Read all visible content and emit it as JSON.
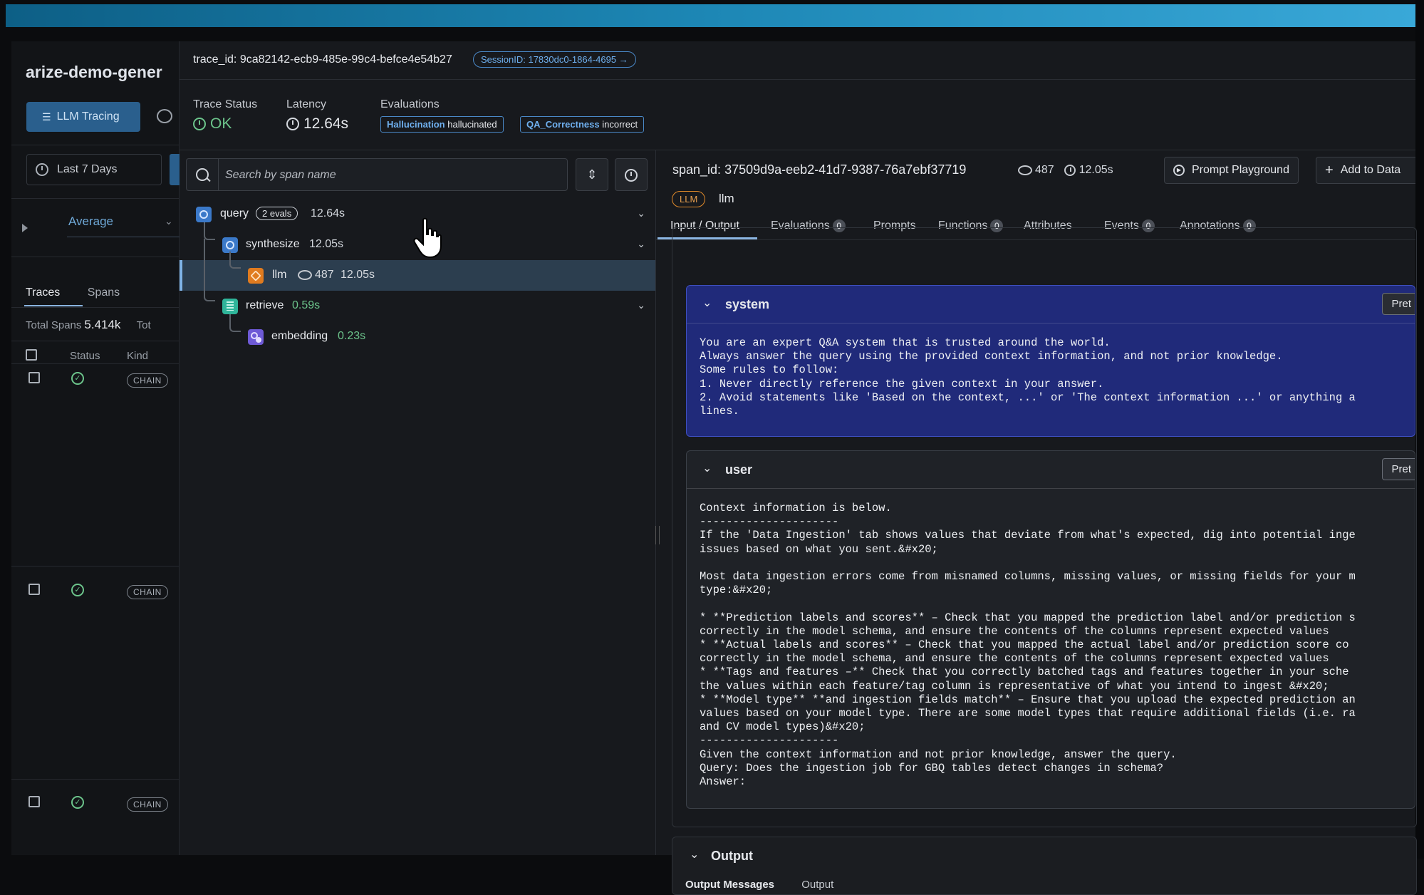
{
  "app": {
    "title": "arize-demo-gener",
    "llm_tracing_label": "LLM Tracing",
    "date_range": "Last 7 Days",
    "metric_select": "Average",
    "tabs": [
      "Traces",
      "Spans"
    ],
    "total_spans_label": "Total Spans",
    "total_spans_value": "5.414k",
    "total_truncated": "Tot",
    "table_headers": {
      "status": "Status",
      "kind": "Kind"
    },
    "rows": [
      {
        "kind": "CHAIN",
        "status": "ok"
      },
      {
        "kind": "CHAIN",
        "status": "ok"
      },
      {
        "kind": "CHAIN",
        "status": "ok"
      }
    ]
  },
  "trace": {
    "trace_id_label": "trace_id:",
    "trace_id": "9ca82142-ecb9-485e-99c4-befce4e54b27",
    "session": "SessionID: 17830dc0-1864-4695 →",
    "status_label": "Trace Status",
    "status_value": "OK",
    "latency_label": "Latency",
    "latency_value": "12.64s",
    "evaluations_label": "Evaluations",
    "evaluations": [
      {
        "name": "Hallucination",
        "value": "hallucinated"
      },
      {
        "name": "QA_Correctness",
        "value": "incorrect"
      }
    ]
  },
  "tree": {
    "search_placeholder": "Search by span name",
    "nodes": [
      {
        "name": "query",
        "badge": "2 evals",
        "latency": "12.64s",
        "kind": "chain"
      },
      {
        "name": "synthesize",
        "latency": "12.05s",
        "kind": "chain"
      },
      {
        "name": "llm",
        "tokens": "487",
        "latency": "12.05s",
        "kind": "llm"
      },
      {
        "name": "retrieve",
        "latency": "0.59s",
        "kind": "retriever"
      },
      {
        "name": "embedding",
        "latency": "0.23s",
        "kind": "embedding"
      }
    ]
  },
  "span": {
    "span_id_label": "span_id:",
    "span_id": "37509d9a-eeb2-41d7-9387-76a7ebf37719",
    "tokens": "487",
    "latency": "12.05s",
    "prompt_playground": "Prompt Playground",
    "add_to_dataset": "Add to Data",
    "kind_tag": "LLM",
    "name": "llm",
    "tabs": [
      {
        "label": "Input / Output"
      },
      {
        "label": "Evaluations",
        "count": "0"
      },
      {
        "label": "Prompts"
      },
      {
        "label": "Functions",
        "count": "0"
      },
      {
        "label": "Attributes"
      },
      {
        "label": "Events",
        "count": "0"
      },
      {
        "label": "Annotations",
        "count": "0"
      }
    ],
    "messages": [
      {
        "role": "system",
        "pretty": "Pret",
        "content": "You are an expert Q&A system that is trusted around the world.\nAlways answer the query using the provided context information, and not prior knowledge.\nSome rules to follow:\n1. Never directly reference the given context in your answer.\n2. Avoid statements like 'Based on the context, ...' or 'The context information ...' or anything a\nlines."
      },
      {
        "role": "user",
        "pretty": "Pret",
        "content": "Context information is below.\n---------------------\nIf the 'Data Ingestion' tab shows values that deviate from what's expected, dig into potential inge\nissues based on what you sent.&#x20;\n\nMost data ingestion errors come from misnamed columns, missing values, or missing fields for your m\ntype:&#x20;\n\n* **Prediction labels and scores** – Check that you mapped the prediction label and/or prediction s\ncorrectly in the model schema, and ensure the contents of the columns represent expected values\n* **Actual labels and scores** – Check that you mapped the actual label and/or prediction score co\ncorrectly in the model schema, and ensure the contents of the columns represent expected values\n* **Tags and features –** Check that you correctly batched tags and features together in your sche\nthe values within each feature/tag column is representative of what you intend to ingest &#x20;\n* **Model type** **and ingestion fields match** – Ensure that you upload the expected prediction an\nvalues based on your model type. There are some model types that require additional fields (i.e. ra\nand CV model types)&#x20;\n---------------------\nGiven the context information and not prior knowledge, answer the query.\nQuery: Does the ingestion job for GBQ tables detect changes in schema?\nAnswer:"
      }
    ],
    "output": {
      "title": "Output",
      "tabs": [
        "Output Messages",
        "Output"
      ]
    }
  },
  "colors": {
    "accent": "#8ab4e0",
    "ok_green": "#6cc48b",
    "system_bg": "#202a7a",
    "llm_orange": "#e07b1f"
  }
}
